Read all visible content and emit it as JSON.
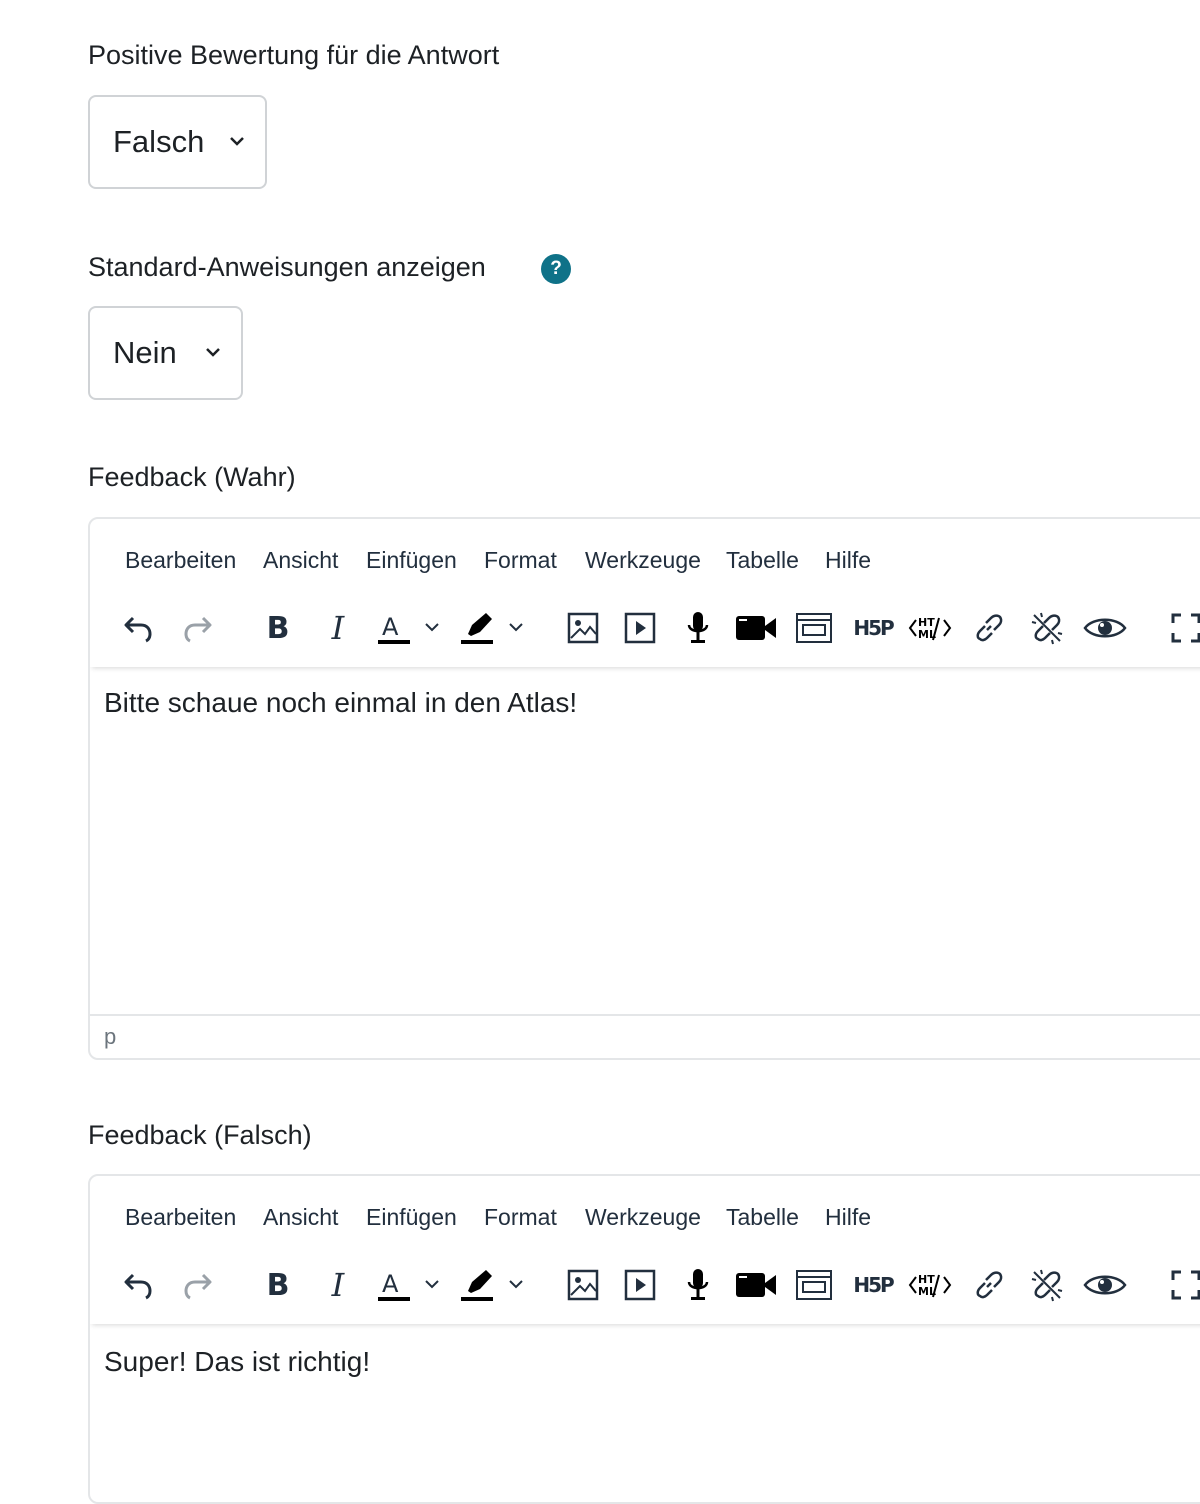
{
  "fields": {
    "positive_rating": {
      "label": "Positive Bewertung für die Antwort",
      "value": "Falsch"
    },
    "show_instructions": {
      "label": "Standard-Anweisungen anzeigen",
      "value": "Nein",
      "help_icon": "question-circle"
    },
    "feedback_true": {
      "label": "Feedback (Wahr)",
      "content": "Bitte schaue noch einmal in den Atlas!",
      "path": "p"
    },
    "feedback_false": {
      "label": "Feedback (Falsch)",
      "content": "Super! Das ist richtig!"
    }
  },
  "editor": {
    "menu": [
      "Bearbeiten",
      "Ansicht",
      "Einfügen",
      "Format",
      "Werkzeuge",
      "Tabelle",
      "Hilfe"
    ],
    "toolbar": {
      "bold_label": "B",
      "italic_label": "I",
      "font_color_label": "A",
      "h5p_label": "H5P",
      "html_label_top": "HT",
      "html_label_bottom": "ML"
    }
  },
  "colors": {
    "help_icon": "#0f7288",
    "text": "#1d2125",
    "toolbar": "#222f3e"
  }
}
